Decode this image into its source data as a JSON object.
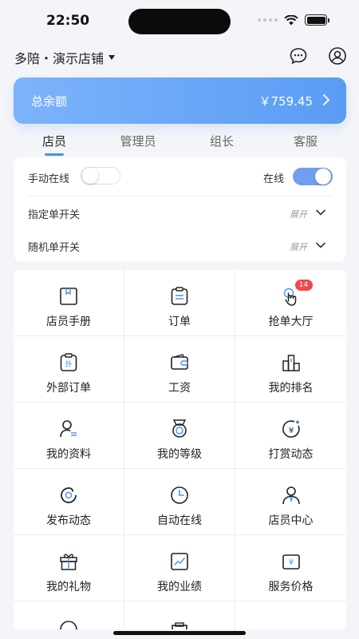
{
  "status_bar": {
    "time": "22:50"
  },
  "header": {
    "store_title": "多陪・演示店铺",
    "icons": [
      "chat-bubble-icon",
      "user-profile-icon"
    ]
  },
  "balance": {
    "label": "总余额",
    "value": "￥759.45"
  },
  "tabs": [
    {
      "label": "店员",
      "active": true
    },
    {
      "label": "管理员",
      "active": false
    },
    {
      "label": "组长",
      "active": false
    },
    {
      "label": "客服",
      "active": false
    }
  ],
  "settings": {
    "manual_online_label": "手动在线",
    "manual_online_on": false,
    "online_label": "在线",
    "online_on": true,
    "assigned_label": "指定单开关",
    "random_label": "随机单开关",
    "expand_label": "展开"
  },
  "grid": [
    {
      "label": "店员手册",
      "icon": "handbook-icon"
    },
    {
      "label": "订单",
      "icon": "clipboard-icon"
    },
    {
      "label": "抢单大厅",
      "icon": "tap-hand-icon",
      "badge": "14"
    },
    {
      "label": "外部订单",
      "icon": "external-order-icon"
    },
    {
      "label": "工资",
      "icon": "wallet-icon"
    },
    {
      "label": "我的排名",
      "icon": "ranking-icon"
    },
    {
      "label": "我的资料",
      "icon": "profile-card-icon"
    },
    {
      "label": "我的等级",
      "icon": "medal-icon"
    },
    {
      "label": "打赏动态",
      "icon": "reward-icon"
    },
    {
      "label": "发布动态",
      "icon": "publish-icon"
    },
    {
      "label": "自动在线",
      "icon": "clock-icon"
    },
    {
      "label": "店员中心",
      "icon": "staff-center-icon"
    },
    {
      "label": "我的礼物",
      "icon": "gift-icon"
    },
    {
      "label": "我的业绩",
      "icon": "performance-icon"
    },
    {
      "label": "服务价格",
      "icon": "price-icon"
    }
  ],
  "colors": {
    "accent": "#5a9cf5",
    "badge": "#f0474e"
  }
}
